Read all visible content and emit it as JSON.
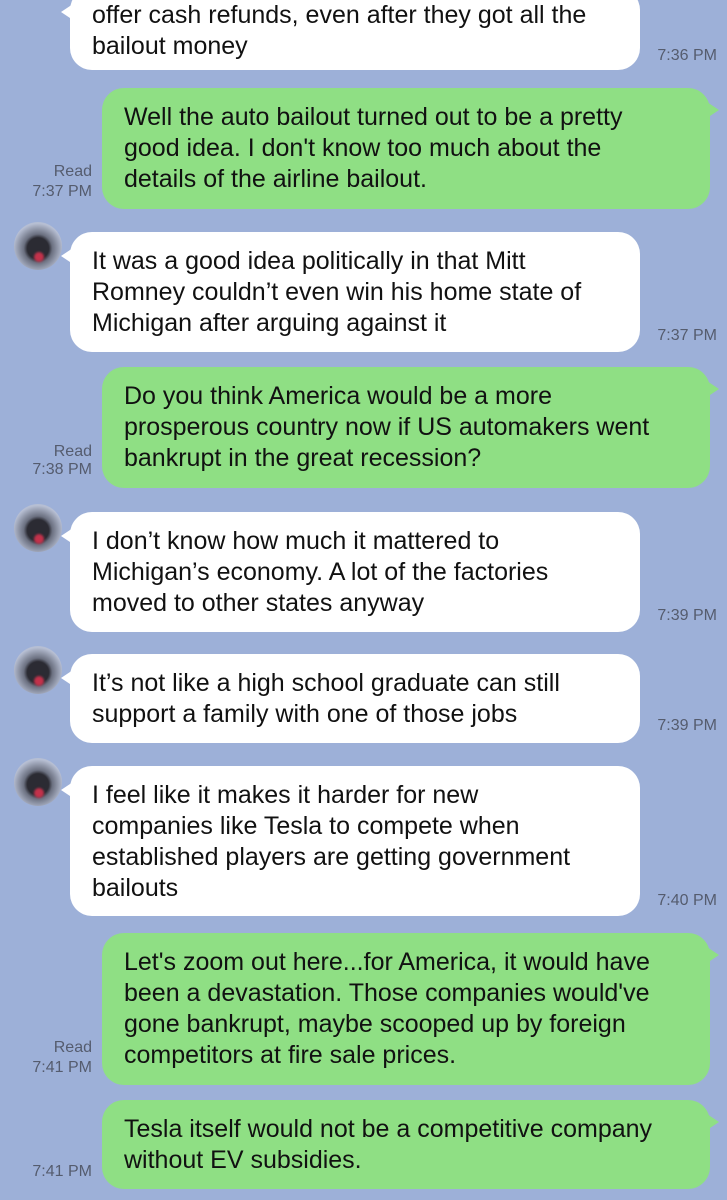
{
  "messages": [
    {
      "text": "offer cash refunds, even after they got all the\nbailout money",
      "time": "7:36 PM"
    },
    {
      "text": "Well the auto bailout turned out to be a pretty\ngood idea. I don't know too much about the\ndetails of the airline bailout.",
      "read": "Read",
      "time": "7:37 PM"
    },
    {
      "text": "It was a good idea politically in that Mitt\nRomney couldn’t even win his home state of\nMichigan after arguing against it",
      "time": "7:37 PM"
    },
    {
      "text": "Do you think America would be a more\nprosperous country now if US automakers went\nbankrupt in the great recession?",
      "read": "Read",
      "time": "7:38 PM"
    },
    {
      "text": "I don’t know how much it mattered to\nMichigan’s economy. A lot of the factories\nmoved to other states anyway",
      "time": "7:39 PM"
    },
    {
      "text": "It’s not like a high school graduate can still\nsupport a family with one of those jobs",
      "time": "7:39 PM"
    },
    {
      "text": "I feel like it makes it harder for new\ncompanies like Tesla to compete when\nestablished players are getting government\nbailouts",
      "time": "7:40 PM"
    },
    {
      "text": "Let's zoom out here...for America, it would have\nbeen a devastation. Those companies would've\ngone bankrupt, maybe scooped up by foreign\ncompetitors at fire sale prices.",
      "read": "Read",
      "time": "7:41 PM"
    },
    {
      "text": "Tesla itself would not be a competitive company\nwithout EV subsidies.",
      "time": "7:41 PM"
    }
  ]
}
